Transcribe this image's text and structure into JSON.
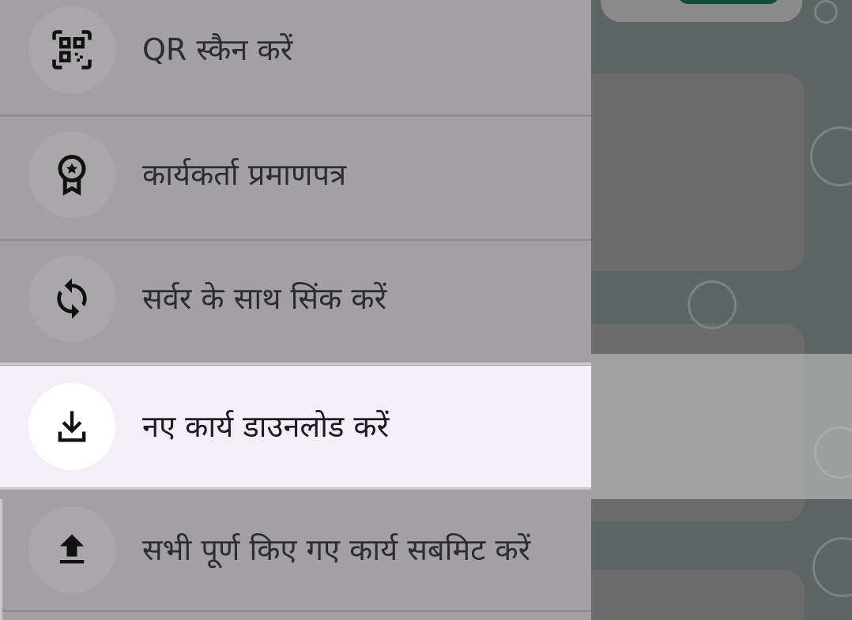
{
  "menu": {
    "items": [
      {
        "icon": "qr-code-scan-icon",
        "label": "QR स्कैन करें"
      },
      {
        "icon": "award-certificate-icon",
        "label": "कार्यकर्ता प्रमाणपत्र"
      },
      {
        "icon": "sync-icon",
        "label": "सर्वर के साथ सिंक करें"
      },
      {
        "icon": "download-icon",
        "label": "नए कार्य डाउनलोड करें",
        "highlighted": true
      },
      {
        "icon": "upload-icon",
        "label": "सभी पूर्ण किए गए कार्य सबमिट करें"
      }
    ]
  },
  "colors": {
    "drawer_background": "#a2a0a3",
    "highlight_background": "#f4eff7",
    "text": "#2d2c2f",
    "accent_dark_green": "#0f4a3a"
  }
}
